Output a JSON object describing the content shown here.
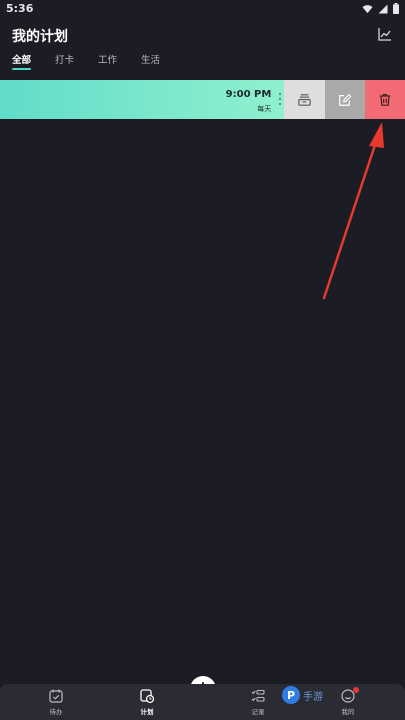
{
  "status_bar": {
    "time": "5:36"
  },
  "header": {
    "title": "我的计划"
  },
  "tabs": [
    {
      "label": "全部",
      "active": true
    },
    {
      "label": "打卡",
      "active": false
    },
    {
      "label": "工作",
      "active": false
    },
    {
      "label": "生活",
      "active": false
    }
  ],
  "plan_item": {
    "time": "9:00 PM",
    "repeat": "每天",
    "gradient_start": "#60dcc8",
    "gradient_end": "#8ff0ce"
  },
  "actions": {
    "archive_color": "#dedede",
    "edit_color": "#a9a9a9",
    "delete_color": "#f26a73"
  },
  "annotation": {
    "arrow_color": "#e8392f"
  },
  "bottom_nav": {
    "items": [
      {
        "label": "待办",
        "icon": "calendar-check-icon"
      },
      {
        "label": "计划",
        "icon": "calendar-clock-icon",
        "active": true
      },
      {
        "label": "记录",
        "icon": "list-check-icon"
      },
      {
        "label": "我的",
        "icon": "smiley-icon"
      }
    ],
    "add_icon": "plus-icon"
  },
  "watermark": {
    "text": "手游"
  }
}
